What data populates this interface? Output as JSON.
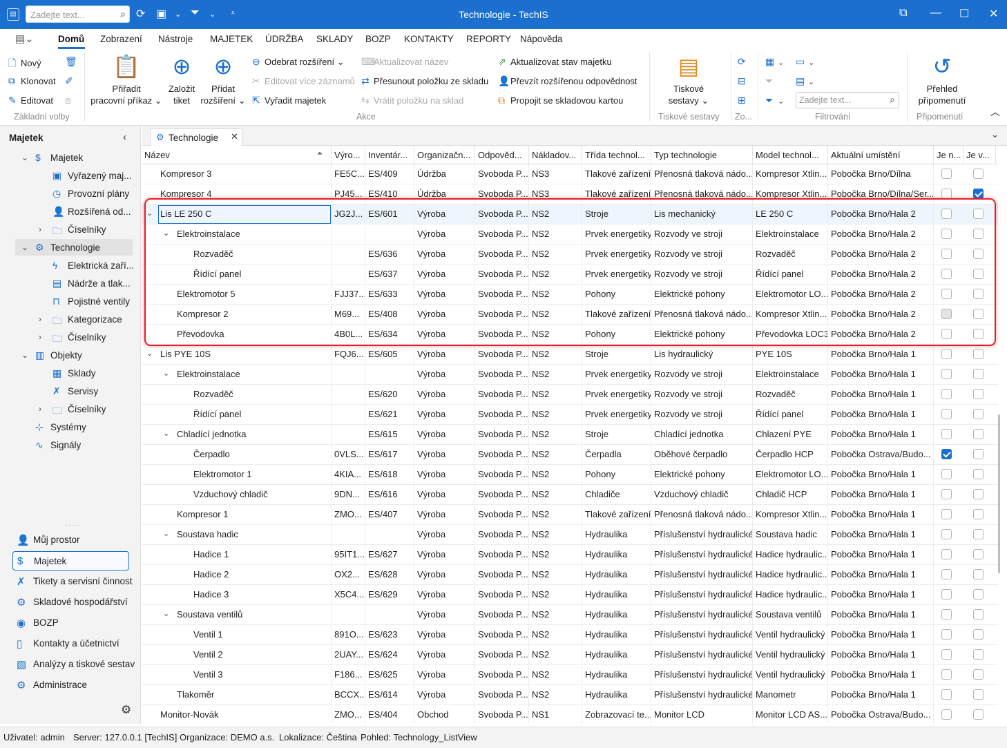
{
  "titlebar": {
    "search_placeholder": "Zadejte text...",
    "title": "Technologie - TechIS"
  },
  "menu": [
    "Domů",
    "Zobrazení",
    "Nástroje",
    "MAJETEK",
    "ÚDRŽBA",
    "SKLADY",
    "BOZP",
    "KONTAKTY",
    "REPORTY",
    "Nápověda"
  ],
  "ribbon": {
    "basic": {
      "new": "Nový",
      "clone": "Klonovat",
      "edit": "Editovat",
      "group": "Základní volby"
    },
    "assign_order": [
      "Přiřadit",
      "pracovní příkaz ⌄"
    ],
    "create_ticket": [
      "Založit",
      "tiket"
    ],
    "add_ext": [
      "Přidat",
      "rozšíření ⌄"
    ],
    "remove_ext": "Odebrat rozšíření ⌄",
    "edit_multi": "Editovat více záznamů",
    "discard": "Vyřadit majetek",
    "update_name": "Aktualizovat název",
    "move_item": "Přesunout položku ze skladu",
    "return_item": "Vrátit položku na sklad",
    "update_state": "Aktualizovat stav majetku",
    "take_resp": "Převzít rozšířenou odpovědnost",
    "link_card": "Propojit se skladovou kartou",
    "actions_group": "Akce",
    "print": [
      "Tiskové",
      "sestavy ⌄"
    ],
    "print_group": "Tiskové sestavy",
    "zoom_group": "Zo...",
    "filter_placeholder": "Zadejte text...",
    "filter_group": "Filtrování",
    "reminders": [
      "Přehled",
      "připomenutí"
    ],
    "reminders_group": "Připomenutí"
  },
  "sidebar": {
    "title": "Majetek",
    "tree": [
      {
        "label": "Majetek",
        "icon": "dollar-icon",
        "level": 0,
        "chev": "⌄"
      },
      {
        "label": "Vyřazený maj...",
        "icon": "box-icon",
        "level": 1
      },
      {
        "label": "Provozní plány",
        "icon": "clock-icon",
        "level": 1
      },
      {
        "label": "Rozšířená od...",
        "icon": "person-icon",
        "level": 1
      },
      {
        "label": "Číselníky",
        "icon": "folder-icon",
        "level": 1,
        "chev": "›"
      },
      {
        "label": "Technologie",
        "icon": "gears-icon",
        "level": 0,
        "chev": "⌄",
        "selected": true
      },
      {
        "label": "Elektrická zaří...",
        "icon": "bolt-icon",
        "level": 1
      },
      {
        "label": "Nádrže a tlak...",
        "icon": "tank-icon",
        "level": 1
      },
      {
        "label": "Pojistné ventily",
        "icon": "valve-icon",
        "level": 1
      },
      {
        "label": "Kategorizace",
        "icon": "folder-icon",
        "level": 1,
        "chev": "›"
      },
      {
        "label": "Číselníky",
        "icon": "folder-icon",
        "level": 1,
        "chev": "›"
      },
      {
        "label": "Objekty",
        "icon": "building-icon",
        "level": 0,
        "chev": "⌄"
      },
      {
        "label": "Sklady",
        "icon": "warehouse-icon",
        "level": 1
      },
      {
        "label": "Servisy",
        "icon": "wrench-icon",
        "level": 1
      },
      {
        "label": "Číselníky",
        "icon": "folder-icon",
        "level": 1,
        "chev": "›"
      },
      {
        "label": "Systémy",
        "icon": "hierarchy-icon",
        "level": 0
      },
      {
        "label": "Signály",
        "icon": "pulse-icon",
        "level": 0
      }
    ],
    "nav": [
      {
        "label": "Můj prostor",
        "icon": "person-icon"
      },
      {
        "label": "Majetek",
        "icon": "dollar-icon",
        "selected": true
      },
      {
        "label": "Tikety a servisní činnost",
        "icon": "wrench-icon"
      },
      {
        "label": "Skladové hospodářství",
        "icon": "gear-icon"
      },
      {
        "label": "BOZP",
        "icon": "shield-icon"
      },
      {
        "label": "Kontakty a účetnictví",
        "icon": "contact-icon"
      },
      {
        "label": "Analýzy a tiskové sestav",
        "icon": "report-icon"
      },
      {
        "label": "Administrace",
        "icon": "gears-icon"
      }
    ]
  },
  "tab": {
    "label": "Technologie"
  },
  "grid": {
    "columns": [
      "Název",
      "Výro...",
      "Inventár...",
      "Organizačn...",
      "Odpověd...",
      "Nákladov...",
      "Třída technol...",
      "Typ technologie",
      "Model technol...",
      "Aktuální umístění",
      "Je n...",
      "Je v..."
    ],
    "rows": [
      {
        "lvl": 1,
        "name": "Kompresor 3",
        "c": [
          "FE5C...",
          "ES/409",
          "Údržba",
          "Svoboda P...",
          "NS3",
          "Tlakové zařízení",
          "Přenosná tlaková nádo...",
          "Kompresor Xtlin...",
          "Pobočka Brno/Dílna"
        ],
        "k1": false,
        "k2": false
      },
      {
        "lvl": 1,
        "name": "Kompresor 4",
        "c": [
          "PJ45...",
          "ES/410",
          "Údržba",
          "Svoboda P...",
          "NS3",
          "Tlakové zařízení",
          "Přenosná tlaková nádo...",
          "Kompresor Xtlin...",
          "Pobočka Brno/Dílna/Ser..."
        ],
        "k1": false,
        "k2": true
      },
      {
        "lvl": 1,
        "exp": true,
        "sel": true,
        "name": "Lis LE 250 C",
        "c": [
          "JG2J...",
          "ES/601",
          "Výroba",
          "Svoboda P...",
          "NS2",
          "Stroje",
          "Lis mechanický",
          "LE 250 C",
          "Pobočka Brno/Hala 2"
        ],
        "k1": false,
        "k2": false
      },
      {
        "lvl": 2,
        "exp": true,
        "name": "Elektroinstalace",
        "c": [
          "",
          "",
          "Výroba",
          "Svoboda P...",
          "NS2",
          "Prvek energetiky",
          "Rozvody ve stroji",
          "Elektroinstalace",
          "Pobočka Brno/Hala 2"
        ],
        "k1": false,
        "k2": false
      },
      {
        "lvl": 3,
        "name": "Rozvaděč",
        "c": [
          "",
          "ES/636",
          "Výroba",
          "Svoboda P...",
          "NS2",
          "Prvek energetiky",
          "Rozvody ve stroji",
          "Rozvaděč",
          "Pobočka Brno/Hala 2"
        ],
        "k1": false,
        "k2": false
      },
      {
        "lvl": 3,
        "name": "Řídící panel",
        "c": [
          "",
          "ES/637",
          "Výroba",
          "Svoboda P...",
          "NS2",
          "Prvek energetiky",
          "Rozvody ve stroji",
          "Řídící panel",
          "Pobočka Brno/Hala 2"
        ],
        "k1": false,
        "k2": false
      },
      {
        "lvl": 2,
        "name": "Elektromotor 5",
        "c": [
          "FJJ37...",
          "ES/633",
          "Výroba",
          "Svoboda P...",
          "NS2",
          "Pohony",
          "Elektrické pohony",
          "Elektromotor LO...",
          "Pobočka Brno/Hala 2"
        ],
        "k1": false,
        "k2": false
      },
      {
        "lvl": 2,
        "name": "Kompresor 2",
        "c": [
          "M69...",
          "ES/408",
          "Výroba",
          "Svoboda P...",
          "NS2",
          "Tlakové zařízení",
          "Přenosná tlaková nádo...",
          "Kompresor Xtlin...",
          "Pobočka Brno/Hala 2"
        ],
        "k1": "gray",
        "k2": false
      },
      {
        "lvl": 2,
        "name": "Převodovka",
        "c": [
          "4B0L...",
          "ES/634",
          "Výroba",
          "Svoboda P...",
          "NS2",
          "Pohony",
          "Elektrické pohony",
          "Převodovka LOC3",
          "Pobočka Brno/Hala 2"
        ],
        "k1": false,
        "k2": false
      },
      {
        "lvl": 1,
        "exp": true,
        "name": "Lis PYE 10S",
        "c": [
          "FQJ6...",
          "ES/605",
          "Výroba",
          "Svoboda P...",
          "NS2",
          "Stroje",
          "Lis hydraulický",
          "PYE 10S",
          "Pobočka Brno/Hala 1"
        ],
        "k1": false,
        "k2": false
      },
      {
        "lvl": 2,
        "exp": true,
        "name": "Elektroinstalace",
        "c": [
          "",
          "",
          "Výroba",
          "Svoboda P...",
          "NS2",
          "Prvek energetiky",
          "Rozvody ve stroji",
          "Elektroinstalace",
          "Pobočka Brno/Hala 1"
        ],
        "k1": false,
        "k2": false
      },
      {
        "lvl": 3,
        "name": "Rozvaděč",
        "c": [
          "",
          "ES/620",
          "Výroba",
          "Svoboda P...",
          "NS2",
          "Prvek energetiky",
          "Rozvody ve stroji",
          "Rozvaděč",
          "Pobočka Brno/Hala 1"
        ],
        "k1": false,
        "k2": false
      },
      {
        "lvl": 3,
        "name": "Řídící panel",
        "c": [
          "",
          "ES/621",
          "Výroba",
          "Svoboda P...",
          "NS2",
          "Prvek energetiky",
          "Rozvody ve stroji",
          "Řídící panel",
          "Pobočka Brno/Hala 1"
        ],
        "k1": false,
        "k2": false
      },
      {
        "lvl": 2,
        "exp": true,
        "name": "Chladící jednotka",
        "c": [
          "",
          "ES/615",
          "Výroba",
          "Svoboda P...",
          "NS2",
          "Stroje",
          "Chladící jednotka",
          "Chlazení PYE",
          "Pobočka Brno/Hala 1"
        ],
        "k1": false,
        "k2": false
      },
      {
        "lvl": 3,
        "name": "Čerpadlo",
        "c": [
          "0VLS...",
          "ES/617",
          "Výroba",
          "Svoboda P...",
          "NS2",
          "Čerpadla",
          "Oběhové čerpadlo",
          "Čerpadlo HCP",
          "Pobočka Ostrava/Budo..."
        ],
        "k1": true,
        "k2": false
      },
      {
        "lvl": 3,
        "name": "Elektromotor 1",
        "c": [
          "4KIA...",
          "ES/618",
          "Výroba",
          "Svoboda P...",
          "NS2",
          "Pohony",
          "Elektrické pohony",
          "Elektromotor LO...",
          "Pobočka Brno/Hala 1"
        ],
        "k1": false,
        "k2": false
      },
      {
        "lvl": 3,
        "name": "Vzduchový chladič",
        "c": [
          "9DN...",
          "ES/616",
          "Výroba",
          "Svoboda P...",
          "NS2",
          "Chladiče",
          "Vzduchový chladič",
          "Chladič HCP",
          "Pobočka Brno/Hala 1"
        ],
        "k1": false,
        "k2": false
      },
      {
        "lvl": 2,
        "name": "Kompresor 1",
        "c": [
          "ZMO...",
          "ES/407",
          "Výroba",
          "Svoboda P...",
          "NS2",
          "Tlakové zařízení",
          "Přenosná tlaková nádo...",
          "Kompresor Xtlin...",
          "Pobočka Brno/Hala 1"
        ],
        "k1": false,
        "k2": false
      },
      {
        "lvl": 2,
        "exp": true,
        "name": "Soustava hadic",
        "c": [
          "",
          "",
          "Výroba",
          "Svoboda P...",
          "NS2",
          "Hydraulika",
          "Příslušenství hydraulické",
          "Soustava hadic",
          "Pobočka Brno/Hala 1"
        ],
        "k1": false,
        "k2": false
      },
      {
        "lvl": 3,
        "name": "Hadice 1",
        "c": [
          "95IT1...",
          "ES/627",
          "Výroba",
          "Svoboda P...",
          "NS2",
          "Hydraulika",
          "Příslušenství hydraulické",
          "Hadice hydraulic...",
          "Pobočka Brno/Hala 1"
        ],
        "k1": false,
        "k2": false
      },
      {
        "lvl": 3,
        "name": "Hadice 2",
        "c": [
          "OX2...",
          "ES/628",
          "Výroba",
          "Svoboda P...",
          "NS2",
          "Hydraulika",
          "Příslušenství hydraulické",
          "Hadice hydraulic...",
          "Pobočka Brno/Hala 1"
        ],
        "k1": false,
        "k2": false
      },
      {
        "lvl": 3,
        "name": "Hadice 3",
        "c": [
          "X5C4...",
          "ES/629",
          "Výroba",
          "Svoboda P...",
          "NS2",
          "Hydraulika",
          "Příslušenství hydraulické",
          "Hadice hydraulic...",
          "Pobočka Brno/Hala 1"
        ],
        "k1": false,
        "k2": false
      },
      {
        "lvl": 2,
        "exp": true,
        "name": "Soustava ventilů",
        "c": [
          "",
          "",
          "Výroba",
          "Svoboda P...",
          "NS2",
          "Hydraulika",
          "Příslušenství hydraulické",
          "Soustava ventilů",
          "Pobočka Brno/Hala 1"
        ],
        "k1": false,
        "k2": false
      },
      {
        "lvl": 3,
        "name": "Ventil 1",
        "c": [
          "891O...",
          "ES/623",
          "Výroba",
          "Svoboda P...",
          "NS2",
          "Hydraulika",
          "Příslušenství hydraulické",
          "Ventil hydraulický",
          "Pobočka Brno/Hala 1"
        ],
        "k1": false,
        "k2": false
      },
      {
        "lvl": 3,
        "name": "Ventil 2",
        "c": [
          "2UAY...",
          "ES/624",
          "Výroba",
          "Svoboda P...",
          "NS2",
          "Hydraulika",
          "Příslušenství hydraulické",
          "Ventil hydraulický",
          "Pobočka Brno/Hala 1"
        ],
        "k1": false,
        "k2": false
      },
      {
        "lvl": 3,
        "name": "Ventil 3",
        "c": [
          "F186...",
          "ES/625",
          "Výroba",
          "Svoboda P...",
          "NS2",
          "Hydraulika",
          "Příslušenství hydraulické",
          "Ventil hydraulický",
          "Pobočka Brno/Hala 1"
        ],
        "k1": false,
        "k2": false
      },
      {
        "lvl": 2,
        "name": "Tlakoměr",
        "c": [
          "BCCX...",
          "ES/614",
          "Výroba",
          "Svoboda P...",
          "NS2",
          "Hydraulika",
          "Příslušenství hydraulické",
          "Manometr",
          "Pobočka Brno/Hala 1"
        ],
        "k1": false,
        "k2": false
      },
      {
        "lvl": 1,
        "name": "Monitor-Novák",
        "c": [
          "ZMO...",
          "ES/404",
          "Obchod",
          "Svoboda P...",
          "NS1",
          "Zobrazovací te...",
          "Monitor LCD",
          "Monitor LCD AS...",
          "Pobočka Ostrava/Budo..."
        ],
        "k1": false,
        "k2": false
      }
    ]
  },
  "status": {
    "user": "Uživatel: admin",
    "server": "Server: 127.0.0.1 [TechIS]",
    "org": "Organizace: DEMO a.s.",
    "loc": "Lokalizace: Čeština",
    "view": "Pohled: Technology_ListView"
  }
}
